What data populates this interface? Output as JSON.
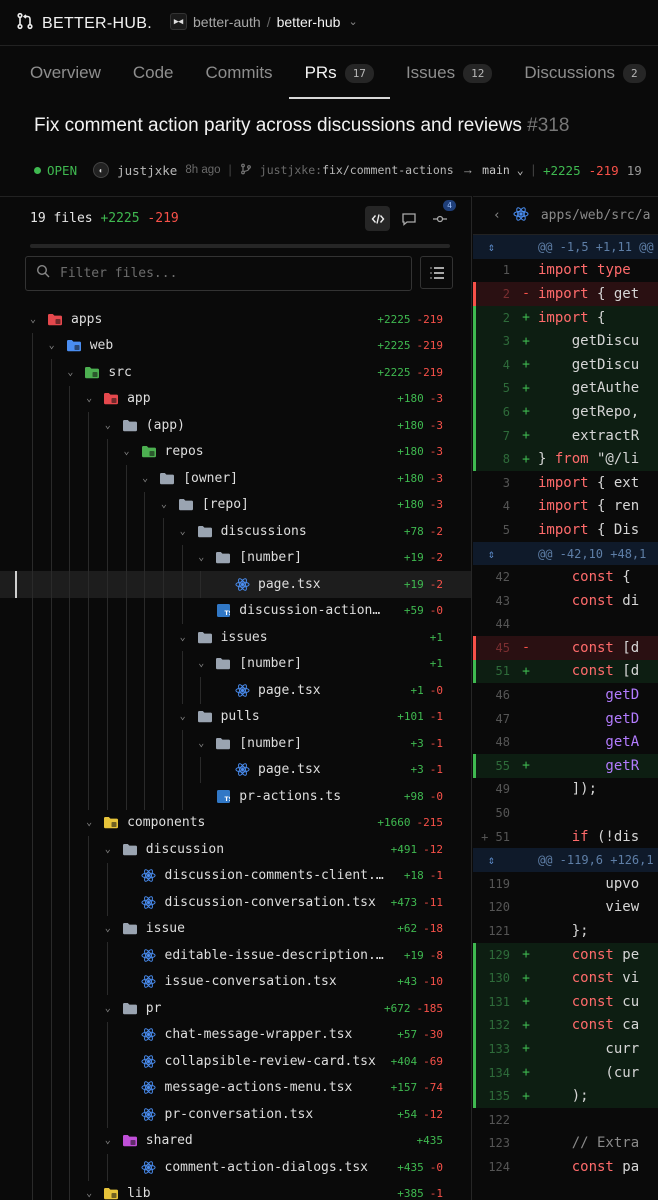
{
  "app": {
    "brand": "BETTER-HUB."
  },
  "breadcrumb": {
    "org": "better-auth",
    "separator": "/",
    "repo": "better-hub"
  },
  "tabs": [
    {
      "label": "Overview",
      "badge": null,
      "active": false
    },
    {
      "label": "Code",
      "badge": null,
      "active": false
    },
    {
      "label": "Commits",
      "badge": null,
      "active": false
    },
    {
      "label": "PRs",
      "badge": "17",
      "active": true
    },
    {
      "label": "Issues",
      "badge": "12",
      "active": false
    },
    {
      "label": "Discussions",
      "badge": "2",
      "active": false
    }
  ],
  "pr": {
    "title": "Fix comment action parity across discussions and reviews",
    "number": "#318",
    "state": "OPEN",
    "author": "justjxke",
    "time": "8h ago",
    "branch_owner": "justjxke:",
    "branch_name": "fix/comment-actions",
    "arrow": "→",
    "base": "main",
    "additions": "+2225",
    "deletions": "-219",
    "files_tail": "19"
  },
  "files": {
    "header": "19 files",
    "additions": "+2225",
    "deletions": "-219",
    "filter_placeholder": "Filter files...",
    "review_badge": "4"
  },
  "tree": [
    {
      "depth": 0,
      "kind": "dir",
      "icon": "folder-apps-icon",
      "color": "#e5484d",
      "name": "apps",
      "add": "+2225",
      "del": "-219",
      "open": true
    },
    {
      "depth": 1,
      "kind": "dir",
      "icon": "folder-web-icon",
      "color": "#4a8df0",
      "name": "web",
      "add": "+2225",
      "del": "-219",
      "open": true
    },
    {
      "depth": 2,
      "kind": "dir",
      "icon": "folder-src-icon",
      "color": "#4caf50",
      "name": "src",
      "add": "+2225",
      "del": "-219",
      "open": true
    },
    {
      "depth": 3,
      "kind": "dir",
      "icon": "folder-app-icon",
      "color": "#e5484d",
      "name": "app",
      "add": "+180",
      "del": "-3",
      "open": true
    },
    {
      "depth": 4,
      "kind": "dir",
      "icon": "folder-icon",
      "color": "#9aa4b1",
      "name": "(app)",
      "add": "+180",
      "del": "-3",
      "open": true
    },
    {
      "depth": 5,
      "kind": "dir",
      "icon": "folder-repos-icon",
      "color": "#4caf50",
      "name": "repos",
      "add": "+180",
      "del": "-3",
      "open": true
    },
    {
      "depth": 6,
      "kind": "dir",
      "icon": "folder-icon",
      "color": "#9aa4b1",
      "name": "[owner]",
      "add": "+180",
      "del": "-3",
      "open": true
    },
    {
      "depth": 7,
      "kind": "dir",
      "icon": "folder-icon",
      "color": "#9aa4b1",
      "name": "[repo]",
      "add": "+180",
      "del": "-3",
      "open": true
    },
    {
      "depth": 8,
      "kind": "dir",
      "icon": "folder-icon",
      "color": "#9aa4b1",
      "name": "discussions",
      "add": "+78",
      "del": "-2",
      "open": true
    },
    {
      "depth": 9,
      "kind": "dir",
      "icon": "folder-icon",
      "color": "#9aa4b1",
      "name": "[number]",
      "add": "+19",
      "del": "-2",
      "open": true
    },
    {
      "depth": 10,
      "kind": "file",
      "icon": "react-icon",
      "color": "#4a8df0",
      "name": "page.tsx",
      "add": "+19",
      "del": "-2",
      "selected": true
    },
    {
      "depth": 9,
      "kind": "file",
      "icon": "typescript-icon",
      "color": "#3178c6",
      "name": "discussion-actions.…",
      "add": "+59",
      "del": "-0"
    },
    {
      "depth": 8,
      "kind": "dir",
      "icon": "folder-icon",
      "color": "#9aa4b1",
      "name": "issues",
      "add": "+1",
      "del": "",
      "open": true
    },
    {
      "depth": 9,
      "kind": "dir",
      "icon": "folder-icon",
      "color": "#9aa4b1",
      "name": "[number]",
      "add": "+1",
      "del": "",
      "open": true
    },
    {
      "depth": 10,
      "kind": "file",
      "icon": "react-icon",
      "color": "#4a8df0",
      "name": "page.tsx",
      "add": "+1",
      "del": "-0"
    },
    {
      "depth": 8,
      "kind": "dir",
      "icon": "folder-icon",
      "color": "#9aa4b1",
      "name": "pulls",
      "add": "+101",
      "del": "-1",
      "open": true
    },
    {
      "depth": 9,
      "kind": "dir",
      "icon": "folder-icon",
      "color": "#9aa4b1",
      "name": "[number]",
      "add": "+3",
      "del": "-1",
      "open": true
    },
    {
      "depth": 10,
      "kind": "file",
      "icon": "react-icon",
      "color": "#4a8df0",
      "name": "page.tsx",
      "add": "+3",
      "del": "-1"
    },
    {
      "depth": 9,
      "kind": "file",
      "icon": "typescript-icon",
      "color": "#3178c6",
      "name": "pr-actions.ts",
      "add": "+98",
      "del": "-0"
    },
    {
      "depth": 3,
      "kind": "dir",
      "icon": "folder-components-icon",
      "color": "#e6c33a",
      "name": "components",
      "add": "+1660",
      "del": "-215",
      "open": true
    },
    {
      "depth": 4,
      "kind": "dir",
      "icon": "folder-icon",
      "color": "#9aa4b1",
      "name": "discussion",
      "add": "+491",
      "del": "-12",
      "open": true
    },
    {
      "depth": 5,
      "kind": "file",
      "icon": "react-icon",
      "color": "#4a8df0",
      "name": "discussion-comments-client.tsx",
      "add": "+18",
      "del": "-1"
    },
    {
      "depth": 5,
      "kind": "file",
      "icon": "react-icon",
      "color": "#4a8df0",
      "name": "discussion-conversation.tsx",
      "add": "+473",
      "del": "-11"
    },
    {
      "depth": 4,
      "kind": "dir",
      "icon": "folder-icon",
      "color": "#9aa4b1",
      "name": "issue",
      "add": "+62",
      "del": "-18",
      "open": true
    },
    {
      "depth": 5,
      "kind": "file",
      "icon": "react-icon",
      "color": "#4a8df0",
      "name": "editable-issue-description.tsx",
      "add": "+19",
      "del": "-8"
    },
    {
      "depth": 5,
      "kind": "file",
      "icon": "react-icon",
      "color": "#4a8df0",
      "name": "issue-conversation.tsx",
      "add": "+43",
      "del": "-10"
    },
    {
      "depth": 4,
      "kind": "dir",
      "icon": "folder-icon",
      "color": "#9aa4b1",
      "name": "pr",
      "add": "+672",
      "del": "-185",
      "open": true
    },
    {
      "depth": 5,
      "kind": "file",
      "icon": "react-icon",
      "color": "#4a8df0",
      "name": "chat-message-wrapper.tsx",
      "add": "+57",
      "del": "-30"
    },
    {
      "depth": 5,
      "kind": "file",
      "icon": "react-icon",
      "color": "#4a8df0",
      "name": "collapsible-review-card.tsx",
      "add": "+404",
      "del": "-69"
    },
    {
      "depth": 5,
      "kind": "file",
      "icon": "react-icon",
      "color": "#4a8df0",
      "name": "message-actions-menu.tsx",
      "add": "+157",
      "del": "-74"
    },
    {
      "depth": 5,
      "kind": "file",
      "icon": "react-icon",
      "color": "#4a8df0",
      "name": "pr-conversation.tsx",
      "add": "+54",
      "del": "-12"
    },
    {
      "depth": 4,
      "kind": "dir",
      "icon": "folder-shared-icon",
      "color": "#c04fd8",
      "name": "shared",
      "add": "+435",
      "del": "",
      "open": true
    },
    {
      "depth": 5,
      "kind": "file",
      "icon": "react-icon",
      "color": "#4a8df0",
      "name": "comment-action-dialogs.tsx",
      "add": "+435",
      "del": "-0"
    },
    {
      "depth": 3,
      "kind": "dir",
      "icon": "folder-lib-icon",
      "color": "#e6c33a",
      "name": "lib",
      "add": "+385",
      "del": "-1",
      "open": true
    }
  ],
  "diff": {
    "path": "apps/web/src/a",
    "lines": [
      {
        "type": "hunk",
        "ln": "",
        "sign": "",
        "code": "@@ -1,5 +1,11 @@"
      },
      {
        "type": "ctx",
        "ln": "1",
        "sign": "",
        "code": "import type"
      },
      {
        "type": "del",
        "ln": "2",
        "sign": "-",
        "code": "import { get"
      },
      {
        "type": "add",
        "ln": "2",
        "sign": "+",
        "code": "import {"
      },
      {
        "type": "add",
        "ln": "3",
        "sign": "+",
        "code": "    getDiscu"
      },
      {
        "type": "add",
        "ln": "4",
        "sign": "+",
        "code": "    getDiscu"
      },
      {
        "type": "add",
        "ln": "5",
        "sign": "+",
        "code": "    getAuthe"
      },
      {
        "type": "add",
        "ln": "6",
        "sign": "+",
        "code": "    getRepo,"
      },
      {
        "type": "add",
        "ln": "7",
        "sign": "+",
        "code": "    extractR"
      },
      {
        "type": "add",
        "ln": "8",
        "sign": "+",
        "code": "} from \"@/li"
      },
      {
        "type": "ctx",
        "ln": "3",
        "sign": "",
        "code": "import { ext"
      },
      {
        "type": "ctx",
        "ln": "4",
        "sign": "",
        "code": "import { ren"
      },
      {
        "type": "ctx",
        "ln": "5",
        "sign": "",
        "code": "import { Dis"
      },
      {
        "type": "hunk",
        "ln": "",
        "sign": "",
        "code": "@@ -42,10 +48,1"
      },
      {
        "type": "ctx",
        "ln": "42",
        "sign": "",
        "code": "    const {"
      },
      {
        "type": "ctx",
        "ln": "43",
        "sign": "",
        "code": "    const di"
      },
      {
        "type": "ctx",
        "ln": "44",
        "sign": "",
        "code": ""
      },
      {
        "type": "del",
        "ln": "45",
        "sign": "-",
        "code": "    const [d"
      },
      {
        "type": "add",
        "ln": "51",
        "sign": "+",
        "code": "    const [d"
      },
      {
        "type": "ctx",
        "ln": "46",
        "sign": "",
        "code": "        getD"
      },
      {
        "type": "ctx",
        "ln": "47",
        "sign": "",
        "code": "        getD"
      },
      {
        "type": "ctx",
        "ln": "48",
        "sign": "",
        "code": "        getA"
      },
      {
        "type": "add",
        "ln": "55",
        "sign": "+",
        "code": "        getR"
      },
      {
        "type": "ctx",
        "ln": "49",
        "sign": "",
        "code": "    ]);"
      },
      {
        "type": "ctx",
        "ln": "50",
        "sign": "",
        "code": ""
      },
      {
        "type": "ctx",
        "ln": "+ 51",
        "sign": "",
        "code": "    if (!dis"
      },
      {
        "type": "hunk",
        "ln": "",
        "sign": "",
        "code": "@@ -119,6 +126,1"
      },
      {
        "type": "ctx",
        "ln": "119",
        "sign": "",
        "code": "        upvo"
      },
      {
        "type": "ctx",
        "ln": "120",
        "sign": "",
        "code": "        view"
      },
      {
        "type": "ctx",
        "ln": "121",
        "sign": "",
        "code": "    };"
      },
      {
        "type": "add",
        "ln": "129",
        "sign": "+",
        "code": "    const pe"
      },
      {
        "type": "add",
        "ln": "130",
        "sign": "+",
        "code": "    const vi"
      },
      {
        "type": "add",
        "ln": "131",
        "sign": "+",
        "code": "    const cu"
      },
      {
        "type": "add",
        "ln": "132",
        "sign": "+",
        "code": "    const ca"
      },
      {
        "type": "add",
        "ln": "133",
        "sign": "+",
        "code": "        curr"
      },
      {
        "type": "add",
        "ln": "134",
        "sign": "+",
        "code": "        (cur"
      },
      {
        "type": "add",
        "ln": "135",
        "sign": "+",
        "code": "    );"
      },
      {
        "type": "ctx",
        "ln": "122",
        "sign": "",
        "code": ""
      },
      {
        "type": "ctx",
        "ln": "123",
        "sign": "",
        "code": "    // Extra"
      },
      {
        "type": "ctx",
        "ln": "124",
        "sign": "",
        "code": "    const pa"
      }
    ]
  }
}
